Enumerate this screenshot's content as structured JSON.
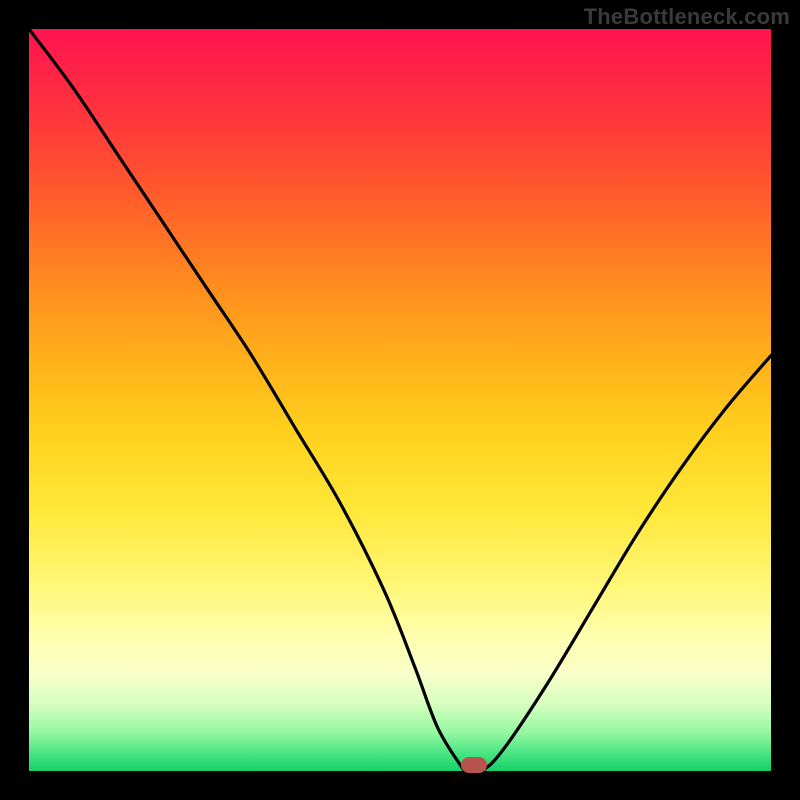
{
  "watermark": "TheBottleneck.com",
  "colors": {
    "frame": "#000000",
    "curve": "#000000",
    "marker": "#b85450",
    "watermark": "#3a3a3a"
  },
  "chart_data": {
    "type": "line",
    "title": "",
    "xlabel": "",
    "ylabel": "",
    "xlim": [
      0,
      100
    ],
    "ylim": [
      0,
      100
    ],
    "series": [
      {
        "name": "bottleneck-curve",
        "x": [
          0,
          6,
          12,
          18,
          24,
          30,
          36,
          42,
          48,
          52,
          55,
          58,
          59,
          61,
          64,
          70,
          76,
          82,
          88,
          94,
          100
        ],
        "y": [
          100,
          92,
          83,
          74,
          65,
          56,
          46,
          36,
          24,
          14,
          6,
          1,
          0,
          0,
          3,
          12,
          22,
          32,
          41,
          49,
          56
        ]
      }
    ],
    "annotations": [
      {
        "name": "optimal-point-marker",
        "x": 60,
        "y": 0.8
      }
    ],
    "grid": false,
    "legend": false,
    "background": "rainbow-vertical"
  }
}
